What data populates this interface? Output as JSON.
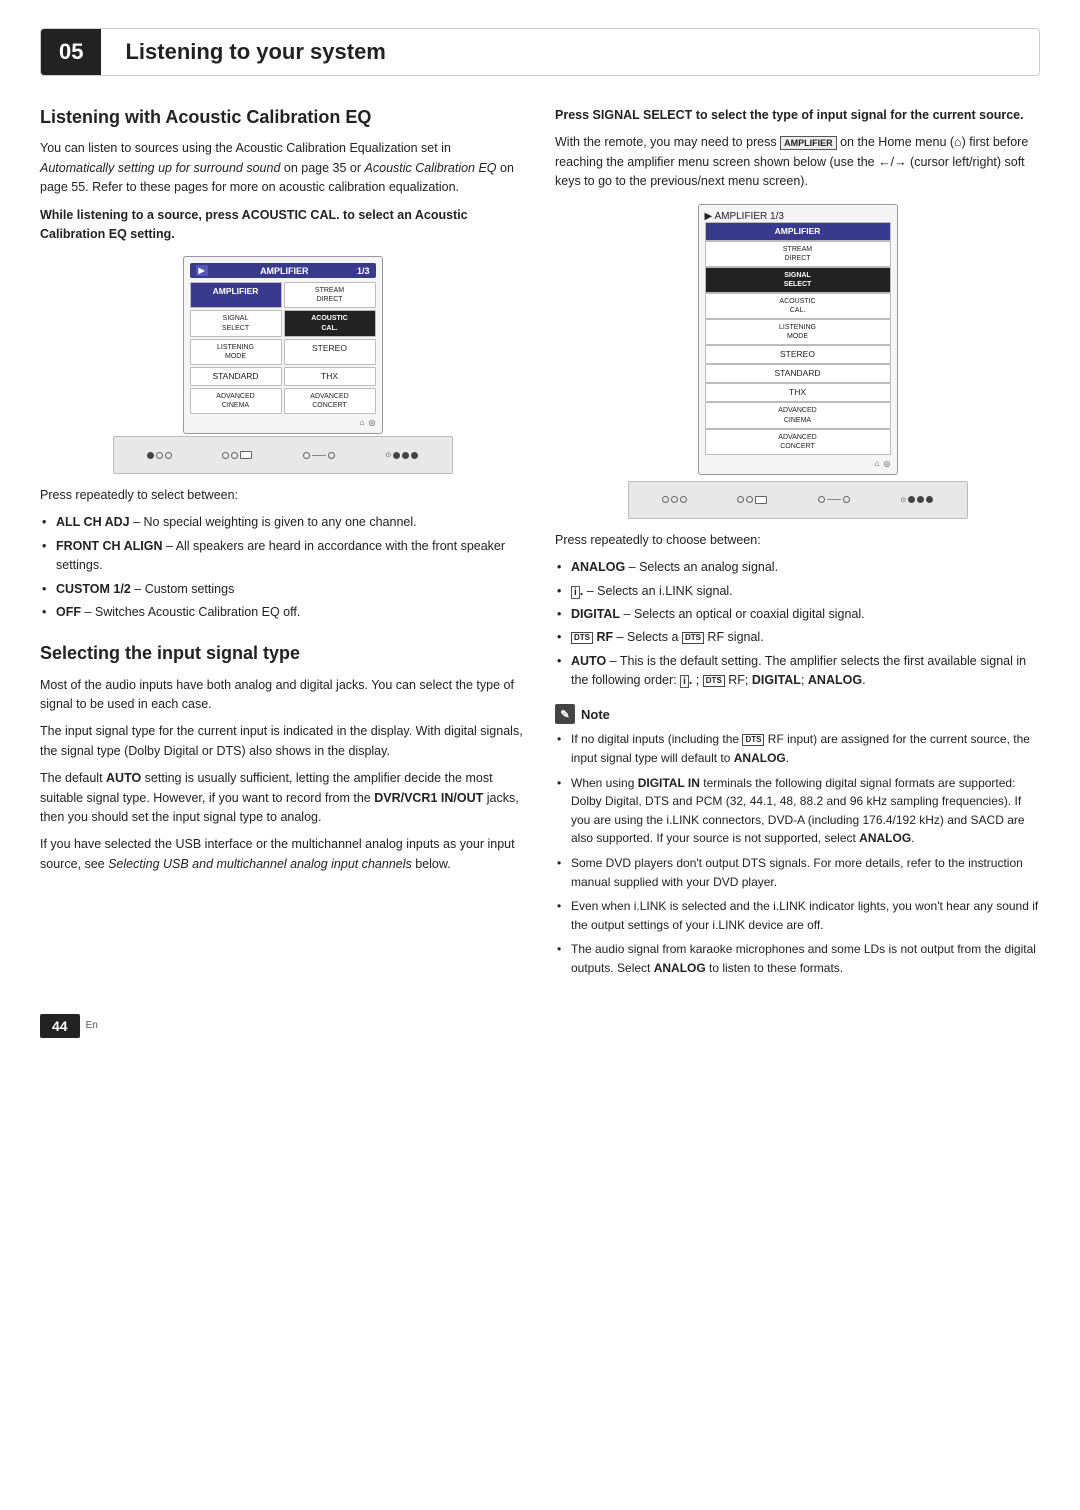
{
  "header": {
    "chapter_num": "05",
    "chapter_title": "Listening to your system"
  },
  "left_column": {
    "section1_title": "Listening with Acoustic Calibration EQ",
    "section1_intro": "You can listen to sources using the Acoustic Calibration Equalization set in ",
    "section1_italic1": "Automatically setting up for surround sound",
    "section1_mid1": " on page 35 or ",
    "section1_italic2": "Acoustic Calibration EQ",
    "section1_mid2": " on page 55. Refer to these pages for more on acoustic calibration equalization.",
    "section1_bullet_header": "While listening to a source, press ACOUSTIC CAL. to select an Acoustic Calibration EQ setting.",
    "amp_header_label": "AMPLIFIER",
    "amp_header_page": "1/3",
    "amp_cells": [
      {
        "label": "AMPLIFIER",
        "type": "highlighted2",
        "col": 1
      },
      {
        "label": "STREAM\nDIRECT",
        "type": "normal",
        "col": 2
      },
      {
        "label": "SIGNAL\nSELECT",
        "type": "normal",
        "col": 1
      },
      {
        "label": "ACOUSTIC\nCAL.",
        "type": "highlighted",
        "col": 2
      },
      {
        "label": "LISTENING\nMODE",
        "type": "normal",
        "col": 1
      },
      {
        "label": "STEREO",
        "type": "normal",
        "col": 2
      },
      {
        "label": "STANDARD",
        "type": "normal",
        "col": 1
      },
      {
        "label": "THX",
        "type": "normal",
        "col": 2
      },
      {
        "label": "ADVANCED\nCINEMA",
        "type": "normal",
        "col": 1
      },
      {
        "label": "ADVANCED\nCONCERT",
        "type": "normal",
        "col": 2
      }
    ],
    "press_text": "Press repeatedly to select between:",
    "bullets": [
      {
        "bold": "ALL CH ADJ",
        "text": " – No special weighting is given to any one channel."
      },
      {
        "bold": "FRONT CH ALIGN",
        "text": " – All speakers are heard in accordance with the front speaker settings."
      },
      {
        "bold": "CUSTOM 1/2",
        "text": " – Custom settings"
      },
      {
        "bold": "OFF",
        "text": " – Switches Acoustic Calibration EQ off."
      }
    ],
    "section2_title": "Selecting the input signal type",
    "section2_p1": "Most of the audio inputs have both analog and digital jacks. You can select the type of signal to be used in each case.",
    "section2_p2": "The input signal type for the current input is indicated in the display. With digital signals, the signal type (Dolby Digital or DTS) also shows in the display.",
    "section2_p3": "The default AUTO setting is usually sufficient, letting the amplifier decide the most suitable signal type. However, if you want to record from the DVR/VCR1 IN/OUT jacks, then you should set the input signal type to analog.",
    "section2_p4": "If you have selected the USB interface or the multichannel analog inputs as your input source, see ",
    "section2_p4_italic": "Selecting USB and multichannel analog input channels",
    "section2_p4_end": " below."
  },
  "right_column": {
    "bullet_header": "Press SIGNAL SELECT to select the type of input signal for the current source.",
    "intro_p1": "With the remote, you may need to press ",
    "intro_amplifier_label": "AMPLIFIER",
    "intro_p2": " on the Home menu (",
    "intro_home_icon": "⌂",
    "intro_p3": ") first before reaching the amplifier menu screen shown below (use the ←/→ (cursor left/right) soft keys to go to the previous/next menu screen).",
    "amp_header_label": "AMPLIFIER",
    "amp_header_page": "1/3",
    "amp_cells_right": [
      {
        "label": "AMPLIFIER",
        "type": "highlighted2"
      },
      {
        "label": "STREAM\nDIRECT",
        "type": "normal"
      },
      {
        "label": "SIGNAL\nSELECT",
        "type": "highlighted"
      },
      {
        "label": "ACOUSTIC\nCAL.",
        "type": "normal"
      },
      {
        "label": "LISTENING\nMODE",
        "type": "normal"
      },
      {
        "label": "STEREO",
        "type": "normal"
      },
      {
        "label": "STANDARD",
        "type": "normal"
      },
      {
        "label": "THX",
        "type": "normal"
      },
      {
        "label": "ADVANCED\nCINEMA",
        "type": "normal"
      },
      {
        "label": "ADVANCED\nCONCERT",
        "type": "normal"
      }
    ],
    "press_text": "Press repeatedly to choose between:",
    "bullets": [
      {
        "bold": "ANALOG",
        "text": " – Selects an analog signal."
      },
      {
        "bold": "i.",
        "text": " – Selects an i.LINK signal.",
        "ilink": true
      },
      {
        "bold": "DIGITAL",
        "text": " – Selects an optical or coaxial digital signal."
      },
      {
        "bold_dts": true,
        "bold": " RF",
        "text": " – Selects a ",
        "dts_mid": true,
        "end": " RF signal."
      },
      {
        "bold": "AUTO",
        "text": " – This is the default setting. The amplifier selects the first available signal in the following order: "
      },
      {
        "order_text": "i.; DTS RF; DIGITAL; ANALOG",
        "indent": true
      }
    ],
    "note_header": "Note",
    "note_items": [
      "If no digital inputs (including the DTS RF input) are assigned for the current source, the input signal type will default to ANALOG.",
      "When using DIGITAL IN terminals the following digital signal formats are supported: Dolby Digital, DTS and PCM (32, 44.1, 48, 88.2 and 96 kHz sampling frequencies). If you are using the i.LINK connectors, DVD-A (including 176.4/192 kHz) and SACD are also supported. If your source is not supported, select ANALOG.",
      "Some DVD players don't output DTS signals. For more details, refer to the instruction manual supplied with your DVD player.",
      "Even when i.LINK is selected and the i.LINK indicator lights, you won't hear any sound if the output settings of your i.LINK device are off.",
      "The audio signal from karaoke microphones and some LDs is not output from the digital outputs. Select ANALOG to listen to these formats."
    ]
  },
  "footer": {
    "page_num": "44",
    "lang": "En"
  }
}
